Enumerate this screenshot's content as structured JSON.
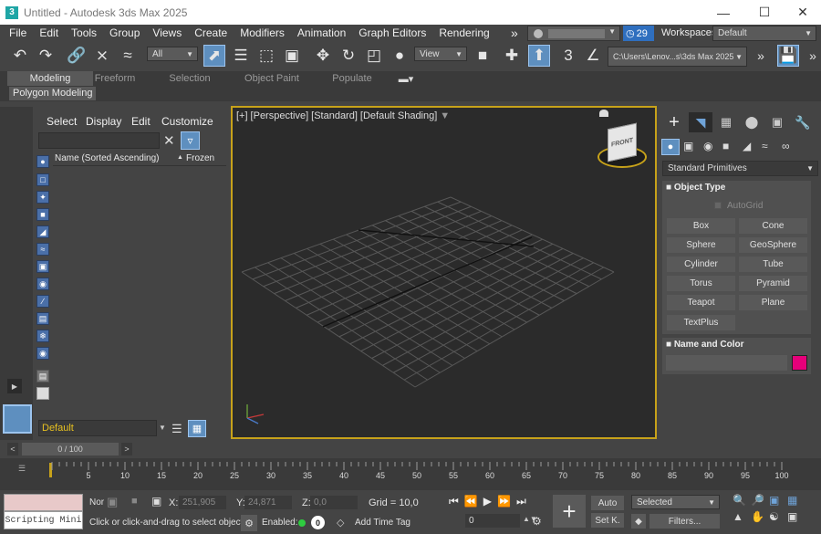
{
  "window": {
    "title": "Untitled - Autodesk 3ds Max 2025",
    "app_icon": "3",
    "controls": [
      "minimize-icon",
      "maximize-icon",
      "close-icon"
    ]
  },
  "menus": [
    "File",
    "Edit",
    "Tools",
    "Group",
    "Views",
    "Create",
    "Modifiers",
    "Animation",
    "Graph Editors",
    "Rendering"
  ],
  "menu_overflow": "»",
  "account": {
    "badge_count": "29"
  },
  "workspaces": {
    "label": "Workspaces:",
    "value": "Default"
  },
  "toolbar": {
    "selection_filter": "All",
    "reference_coord": "View",
    "project_path": "C:\\Users\\Lenov...s\\3ds Max 2025",
    "snaps_label": "3",
    "icons": [
      "undo-icon",
      "redo-icon",
      "link-icon",
      "unlink-icon",
      "bind-spacewarp-icon",
      "select-icon",
      "select-by-name-icon",
      "rect-region-icon",
      "window-crossing-icon",
      "move-icon",
      "rotate-icon",
      "scale-icon",
      "place-icon",
      "mirror-icon",
      "align-icon",
      "snap-toggle-icon",
      "angle-snap-icon"
    ]
  },
  "ribbon": {
    "tabs": [
      "Modeling",
      "Freeform",
      "Selection",
      "Object Paint",
      "Populate"
    ],
    "active_tab": "Modeling",
    "panel_label": "Polygon Modeling"
  },
  "scene_explorer": {
    "menus": [
      "Select",
      "Display",
      "Edit",
      "Customize"
    ],
    "column_name": "Name (Sorted Ascending)",
    "column_frozen": "Frozen",
    "sort_arrow": "▲",
    "layer": "Default",
    "filter_icons": [
      "geometry-icon",
      "shapes-icon",
      "lights-icon",
      "cameras-icon",
      "helpers-icon",
      "spacewarps-icon",
      "groups-icon",
      "xrefs-icon",
      "bones-icon",
      "containers-icon",
      "frozen-icon",
      "hidden-icon"
    ]
  },
  "viewport": {
    "labels": [
      "[+]",
      "[Perspective]",
      "[Standard]",
      "[Default Shading]"
    ],
    "viewcube_text": "FRONT"
  },
  "command_panel": {
    "dropdown": "Standard Primitives",
    "object_type_title": "Object Type",
    "autogrid": "AutoGrid",
    "buttons": [
      "Box",
      "Cone",
      "Sphere",
      "GeoSphere",
      "Cylinder",
      "Tube",
      "Torus",
      "Pyramid",
      "Teapot",
      "Plane",
      "TextPlus"
    ],
    "name_color_title": "Name and Color",
    "object_color": "#e6007a"
  },
  "timeline": {
    "slider": "0 / 100",
    "ticks": [
      "5",
      "10",
      "15",
      "20",
      "25",
      "30",
      "35",
      "40",
      "45",
      "50",
      "55",
      "60",
      "65",
      "70",
      "75",
      "80",
      "85",
      "90",
      "95",
      "100"
    ]
  },
  "status": {
    "script_label": "Scripting Mini",
    "nor_label": "Nor",
    "x_label": "X:",
    "x_value": "251,905",
    "y_label": "Y:",
    "y_value": "24,871",
    "z_label": "Z:",
    "z_value": "0,0",
    "grid": "Grid = 10,0",
    "prompt": "Click or click-and-drag to select objects",
    "enabled_label": "Enabled:",
    "enabled_value": "0",
    "add_time_tag": "Add Time Tag",
    "auto_label": "Auto",
    "setk_label": "Set K.",
    "key_filter": "Selected",
    "filters_label": "Filters...",
    "frame": "0"
  },
  "colors": {
    "accent": "#5e8fbf",
    "viewport_border": "#c7a21a",
    "pink": "#e6007a"
  }
}
